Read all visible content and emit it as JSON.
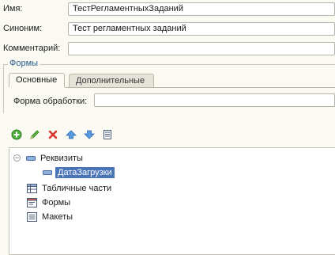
{
  "form": {
    "name": {
      "label": "Имя:",
      "value": "ТестРегламентныхЗаданий"
    },
    "synonym": {
      "label": "Синоним:",
      "value": "Тест регламентных заданий"
    },
    "comment": {
      "label": "Комментарий:",
      "value": ""
    }
  },
  "forms_group": {
    "title": "Формы",
    "tabs": [
      {
        "label": "Основные",
        "active": true
      },
      {
        "label": "Дополнительные",
        "active": false
      }
    ],
    "processing_form": {
      "label": "Форма обработки:",
      "value": ""
    }
  },
  "toolbar": {
    "buttons": [
      {
        "name": "add-button",
        "icon": "plus-circle-icon",
        "color": "#3a9a2a"
      },
      {
        "name": "edit-button",
        "icon": "pencil-icon",
        "color": "#3a8a2a"
      },
      {
        "name": "delete-button",
        "icon": "red-x-icon",
        "color": "#d53a2a"
      },
      {
        "name": "move-up-button",
        "icon": "arrow-up-icon",
        "color": "#3b78c8"
      },
      {
        "name": "move-down-button",
        "icon": "arrow-down-icon",
        "color": "#3b78c8"
      },
      {
        "name": "list-button",
        "icon": "document-list-icon",
        "color": "#5a6a8a"
      }
    ]
  },
  "tree": {
    "items": [
      {
        "label": "Реквизиты",
        "expanded": true
      },
      {
        "label": "ДатаЗагрузки",
        "selected": true
      },
      {
        "label": "Табличные части"
      },
      {
        "label": "Формы"
      },
      {
        "label": "Макеты"
      }
    ]
  }
}
